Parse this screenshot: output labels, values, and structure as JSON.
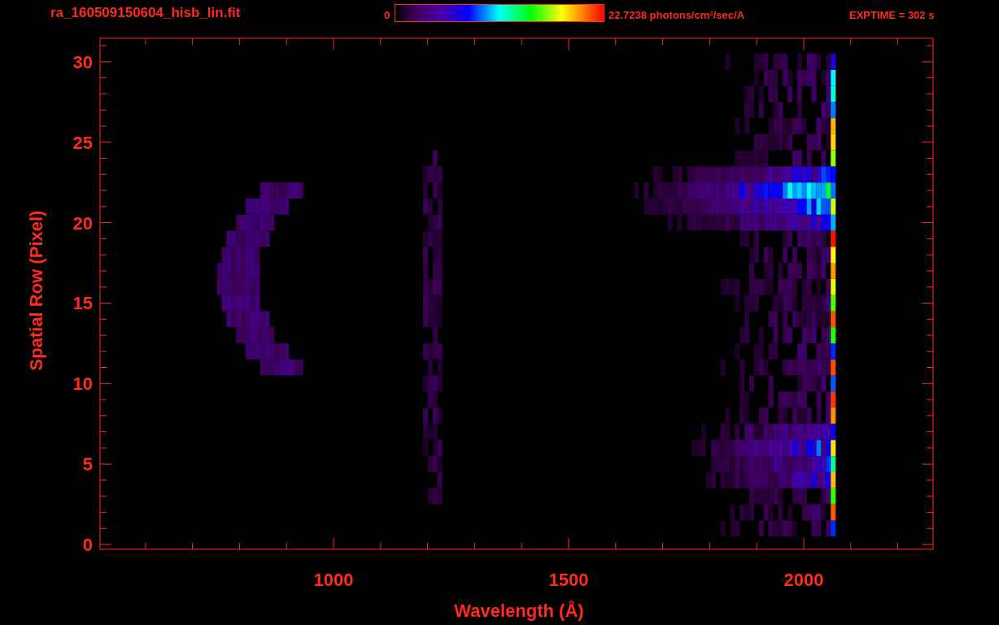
{
  "header": {
    "filename": "ra_160509150604_hisb_lin.fit",
    "colorbar": {
      "min_label": "0",
      "max_label": "22.7238 photons/cm$^{2}$/sec/A"
    },
    "exposure": "EXPTIME = 302 s"
  },
  "plot": {
    "xlabel": "Wavelength (Å)",
    "ylabel": "Spatial Row (Pixel)",
    "xticks": [
      "1000",
      "1500",
      "2000"
    ],
    "yticks": [
      "30",
      "25",
      "20",
      "15",
      "10",
      "5",
      "0"
    ]
  }
}
